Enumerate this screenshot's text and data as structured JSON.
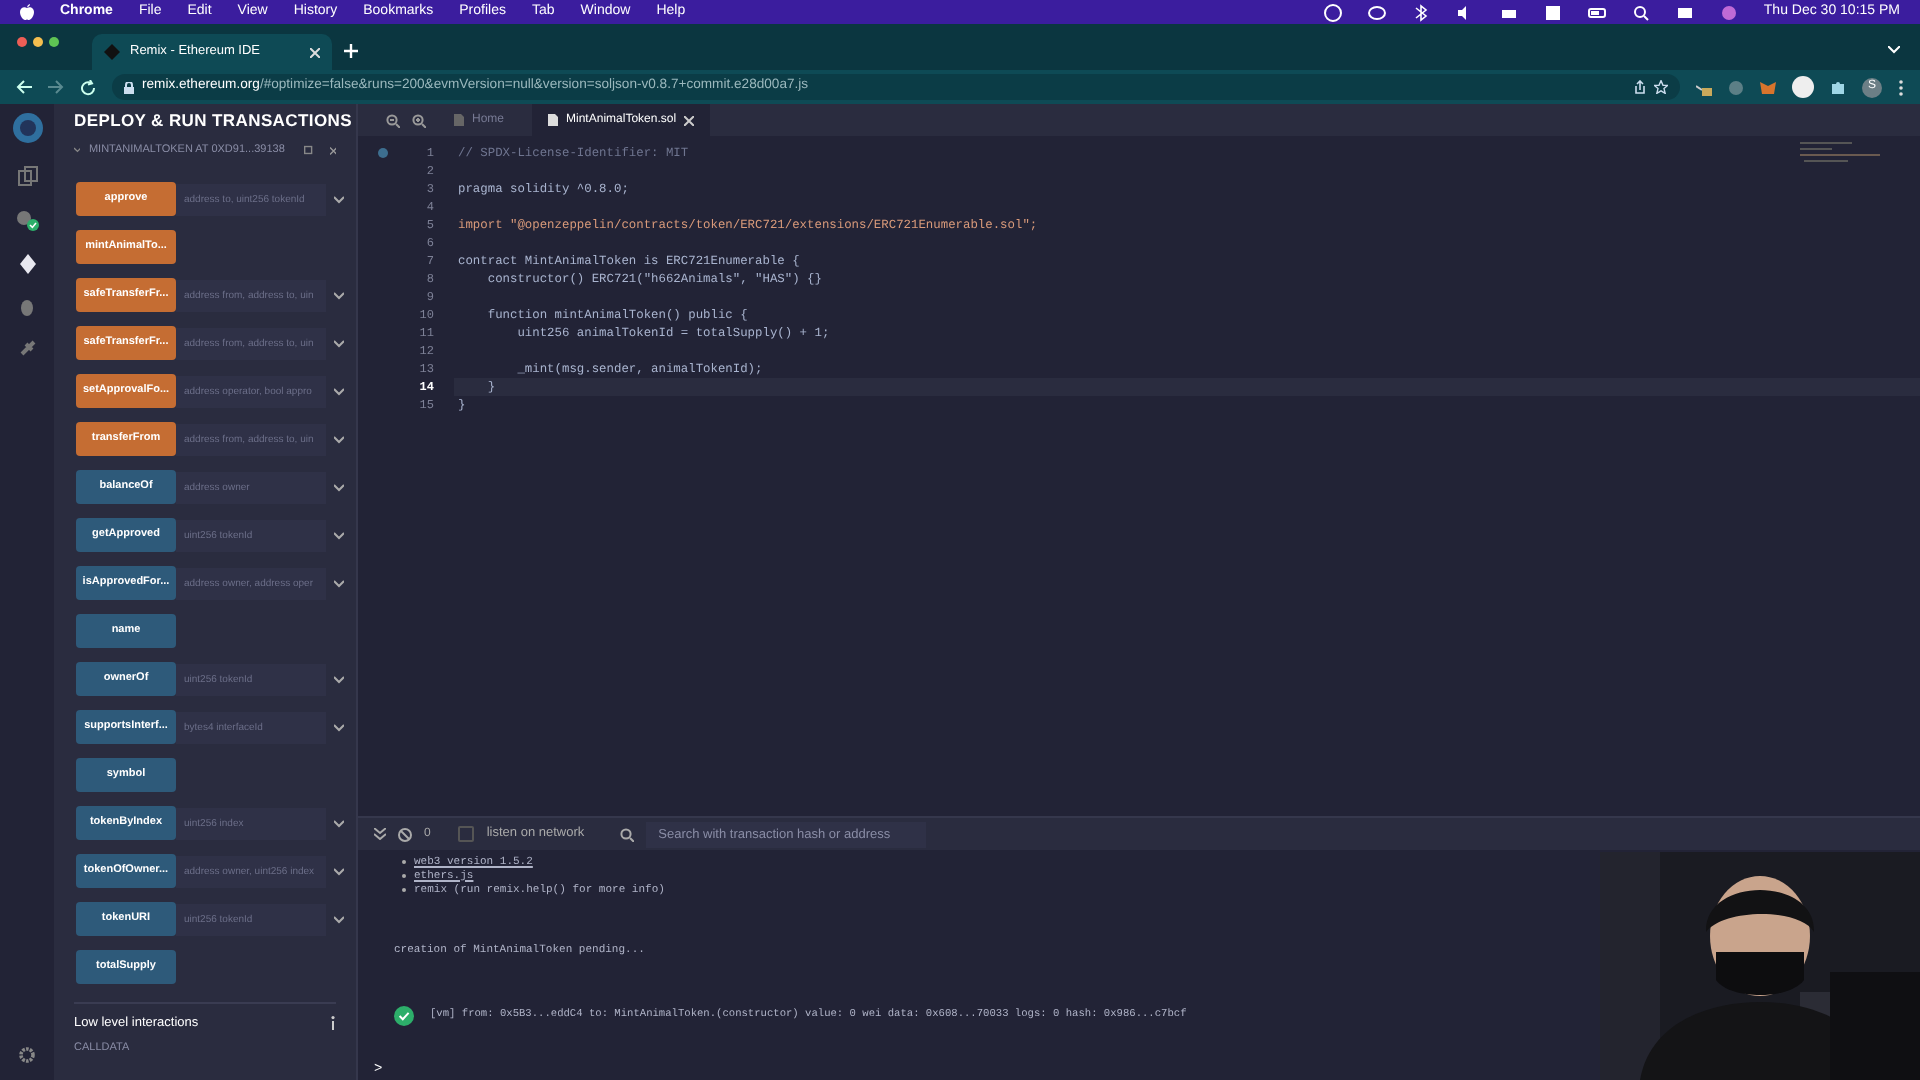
{
  "menu_bar": {
    "app": "Chrome",
    "items": [
      "File",
      "Edit",
      "View",
      "History",
      "Bookmarks",
      "Profiles",
      "Tab",
      "Window",
      "Help"
    ],
    "clock": "Thu Dec 30  10:15 PM"
  },
  "browser": {
    "tab_title": "Remix - Ethereum IDE",
    "url_host": "remix.ethereum.org",
    "url_rest": "/#optimize=false&runs=200&evmVersion=null&version=soljson-v0.8.7+commit.e28d00a7.js",
    "profile_initial": "S"
  },
  "side_panel": {
    "title": "DEPLOY & RUN TRANSACTIONS",
    "contract": "MINTANIMALTOKEN AT 0XD91...39138",
    "functions": [
      {
        "label": "approve",
        "kind": "transact",
        "placeholder": "address to, uint256 tokenId",
        "expandable": true
      },
      {
        "label": "mintAnimalTo...",
        "kind": "transact",
        "expandable": false
      },
      {
        "label": "safeTransferFr...",
        "kind": "transact",
        "placeholder": "address from, address to, uin",
        "expandable": true
      },
      {
        "label": "safeTransferFr...",
        "kind": "transact",
        "placeholder": "address from, address to, uin",
        "expandable": true
      },
      {
        "label": "setApprovalFo...",
        "kind": "transact",
        "placeholder": "address operator, bool appro",
        "expandable": true
      },
      {
        "label": "transferFrom",
        "kind": "transact",
        "placeholder": "address from, address to, uin",
        "expandable": true
      },
      {
        "label": "balanceOf",
        "kind": "call",
        "placeholder": "address owner",
        "expandable": true
      },
      {
        "label": "getApproved",
        "kind": "call",
        "placeholder": "uint256 tokenId",
        "expandable": true
      },
      {
        "label": "isApprovedFor...",
        "kind": "call",
        "placeholder": "address owner, address oper",
        "expandable": true
      },
      {
        "label": "name",
        "kind": "call",
        "expandable": false
      },
      {
        "label": "ownerOf",
        "kind": "call",
        "placeholder": "uint256 tokenId",
        "expandable": true
      },
      {
        "label": "supportsInterf...",
        "kind": "call",
        "placeholder": "bytes4 interfaceId",
        "expandable": true
      },
      {
        "label": "symbol",
        "kind": "call",
        "expandable": false
      },
      {
        "label": "tokenByIndex",
        "kind": "call",
        "placeholder": "uint256 index",
        "expandable": true
      },
      {
        "label": "tokenOfOwner...",
        "kind": "call",
        "placeholder": "address owner, uint256 index",
        "expandable": true
      },
      {
        "label": "tokenURI",
        "kind": "call",
        "placeholder": "uint256 tokenId",
        "expandable": true
      },
      {
        "label": "totalSupply",
        "kind": "call",
        "expandable": false
      }
    ],
    "low_level_title": "Low level interactions",
    "calldata_label": "CALLDATA"
  },
  "editor": {
    "tabs": [
      {
        "label": "Home",
        "selected": false,
        "closable": false
      },
      {
        "label": "MintAnimalToken.sol",
        "selected": true,
        "closable": true
      }
    ],
    "lines": [
      {
        "number": "1",
        "text": "// SPDX-License-Identifier: MIT",
        "kind": "comment",
        "current": false
      },
      {
        "number": "2",
        "current": false
      },
      {
        "number": "3",
        "text": "pragma solidity ^0.8.0;",
        "kind": "code",
        "current": false
      },
      {
        "number": "4",
        "current": false
      },
      {
        "number": "5",
        "text": "import \"@openzeppelin/contracts/token/ERC721/extensions/ERC721Enumerable.sol\";",
        "kind": "string",
        "current": false
      },
      {
        "number": "6",
        "current": false
      },
      {
        "number": "7",
        "text": "contract MintAnimalToken is ERC721Enumerable {",
        "kind": "code",
        "current": false
      },
      {
        "number": "8",
        "text": "    constructor() ERC721(\"h662Animals\", \"HAS\") {}",
        "kind": "code",
        "current": false
      },
      {
        "number": "9",
        "current": false
      },
      {
        "number": "10",
        "text": "    function mintAnimalToken() public {",
        "kind": "code",
        "current": false
      },
      {
        "number": "11",
        "text": "        uint256 animalTokenId = totalSupply() + 1;",
        "kind": "code",
        "current": false
      },
      {
        "number": "12",
        "current": false
      },
      {
        "number": "13",
        "text": "        _mint(msg.sender, animalTokenId);",
        "kind": "code",
        "current": false
      },
      {
        "number": "14",
        "text": "    }",
        "kind": "code",
        "current": true
      },
      {
        "number": "15",
        "text": "}",
        "kind": "code",
        "current": false
      }
    ]
  },
  "terminal": {
    "pending_count": "0",
    "listen_label": "listen on network",
    "listen_checked": false,
    "search_placeholder": "Search with transaction hash or address",
    "info_items": [
      {
        "text": "web3 version 1.5.2",
        "link": true
      },
      {
        "text": "ethers.js",
        "link": true
      },
      {
        "text": "remix (run remix.help() for more info)",
        "link": false
      }
    ],
    "pending": "creation of MintAnimalToken pending...",
    "log": {
      "text": "[vm]  from: 0x5B3...eddC4 to: MintAnimalToken.(constructor) value: 0 wei data: 0x608...70033 logs: 0 hash: 0x986...c7bcf"
    },
    "prompt": ">"
  }
}
